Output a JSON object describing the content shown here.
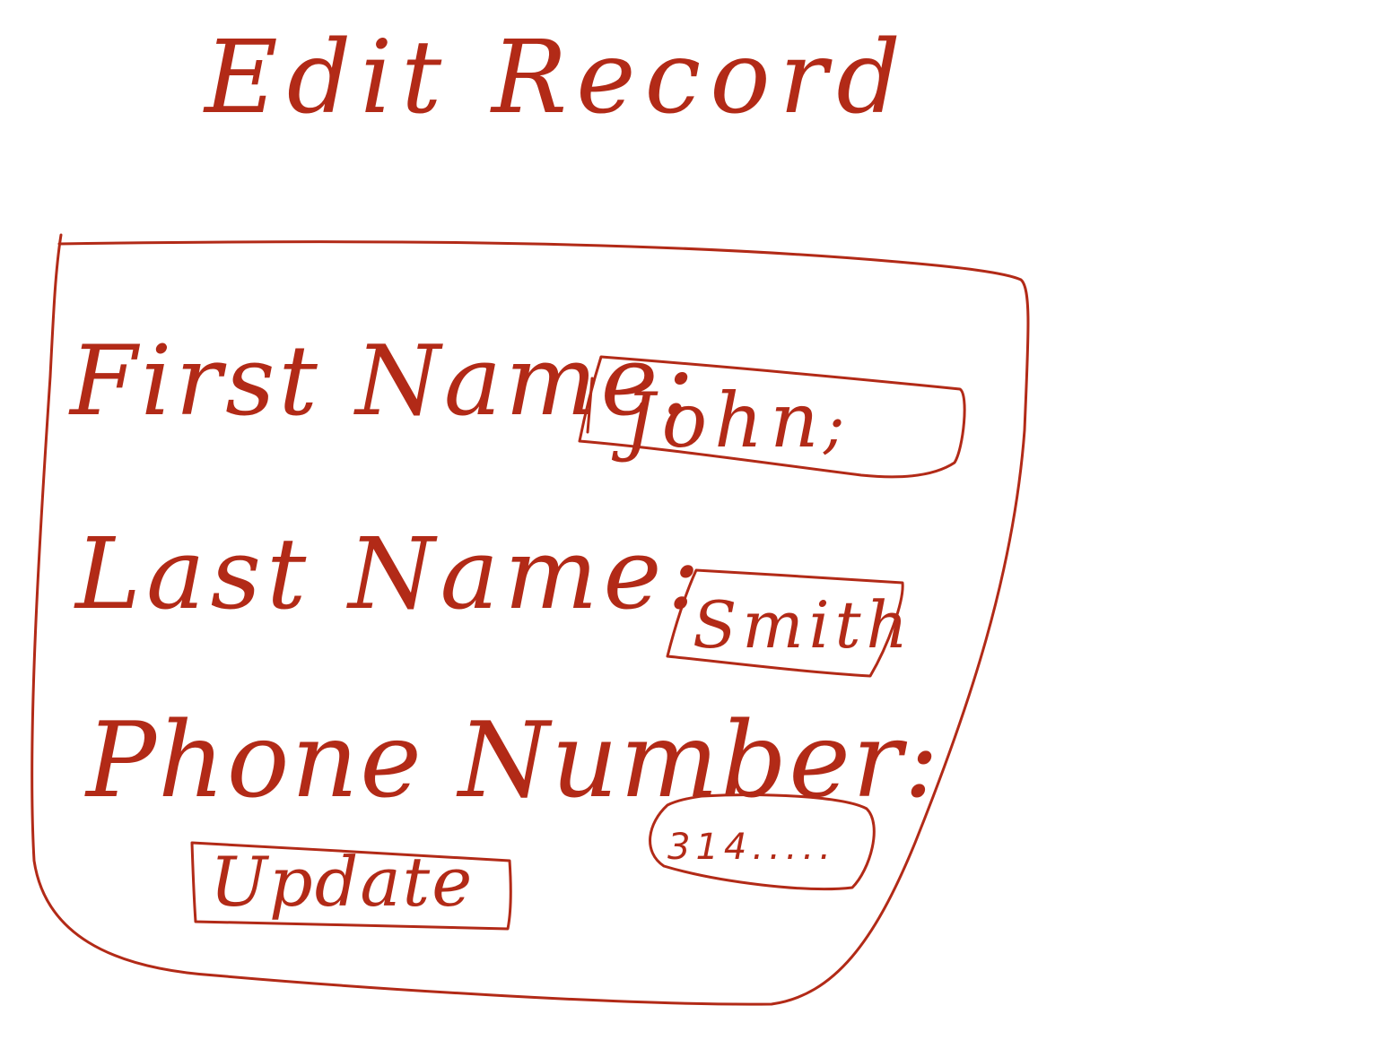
{
  "colors": {
    "ink": "#b22a17",
    "background": "#ffffff"
  },
  "title": "Edit Record",
  "form": {
    "first_name": {
      "label": "First Name:",
      "value": "John"
    },
    "last_name": {
      "label": "Last Name:",
      "value": "Smith"
    },
    "phone_number": {
      "label": "Phone Number:",
      "value": "314....."
    },
    "update_button": {
      "label": "Update"
    }
  }
}
